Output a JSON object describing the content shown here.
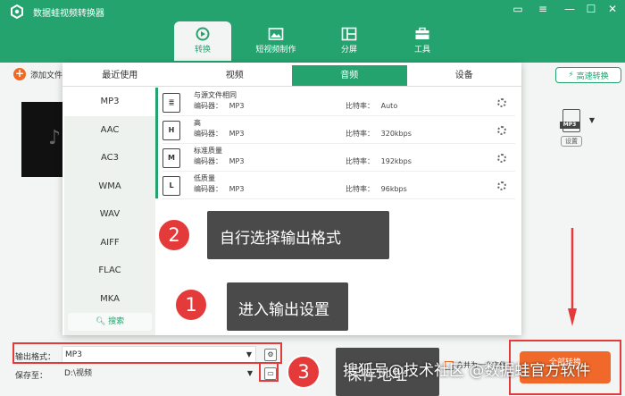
{
  "window": {
    "title": "数据蛙视频转换器",
    "controls": [
      "minimize",
      "maximize-restore",
      "close"
    ]
  },
  "main_tabs": [
    {
      "label": "转换",
      "icon": "convert-icon",
      "active": true
    },
    {
      "label": "短视频制作",
      "icon": "image-frame-icon",
      "active": false
    },
    {
      "label": "分屏",
      "icon": "split-screen-icon",
      "active": false
    },
    {
      "label": "工具",
      "icon": "toolbox-icon",
      "active": false
    }
  ],
  "toolbar": {
    "add_file_label": "添加文件",
    "speed_convert_label": "高速转换"
  },
  "output_format_thumb": {
    "badge": "MP3",
    "settings_label": "设置"
  },
  "format_panel": {
    "tabs": [
      {
        "label": "最近使用",
        "active": false
      },
      {
        "label": "视频",
        "active": false
      },
      {
        "label": "音频",
        "active": true
      },
      {
        "label": "设备",
        "active": false
      }
    ],
    "formats": [
      "MP3",
      "AAC",
      "AC3",
      "WMA",
      "WAV",
      "AIFF",
      "FLAC",
      "MKA"
    ],
    "selected_format": "MP3",
    "search_label": "搜索",
    "presets": [
      {
        "name": "与源文件相同",
        "encoder_label": "编码器：",
        "encoder": "MP3",
        "bitrate_label": "比特率：",
        "bitrate": "Auto",
        "icon_glyph": "≣"
      },
      {
        "name": "高",
        "encoder_label": "编码器：",
        "encoder": "MP3",
        "bitrate_label": "比特率：",
        "bitrate": "320kbps",
        "icon_glyph": "H"
      },
      {
        "name": "标准质量",
        "encoder_label": "编码器：",
        "encoder": "MP3",
        "bitrate_label": "比特率：",
        "bitrate": "192kbps",
        "icon_glyph": "M"
      },
      {
        "name": "低质量",
        "encoder_label": "编码器：",
        "encoder": "MP3",
        "bitrate_label": "比特率：",
        "bitrate": "96kbps",
        "icon_glyph": "L"
      }
    ]
  },
  "annotations": [
    {
      "number": "2",
      "text": "自行选择输出格式"
    },
    {
      "number": "1",
      "text": "进入输出设置"
    },
    {
      "number": "3",
      "text": "保存地址"
    }
  ],
  "bottom_bar": {
    "output_format_label": "输出格式：",
    "output_format_value": "MP3",
    "save_to_label": "保存至：",
    "save_to_value": "D:\\视频",
    "merge_label": "合并为一个文件",
    "convert_all_label": "全部转换"
  },
  "watermark": "搜狐号@技术社区 @数据蛙官方软件",
  "colors": {
    "brand_green": "#24a36f",
    "accent_orange": "#f0692a",
    "highlight_red": "#e53a3a"
  }
}
